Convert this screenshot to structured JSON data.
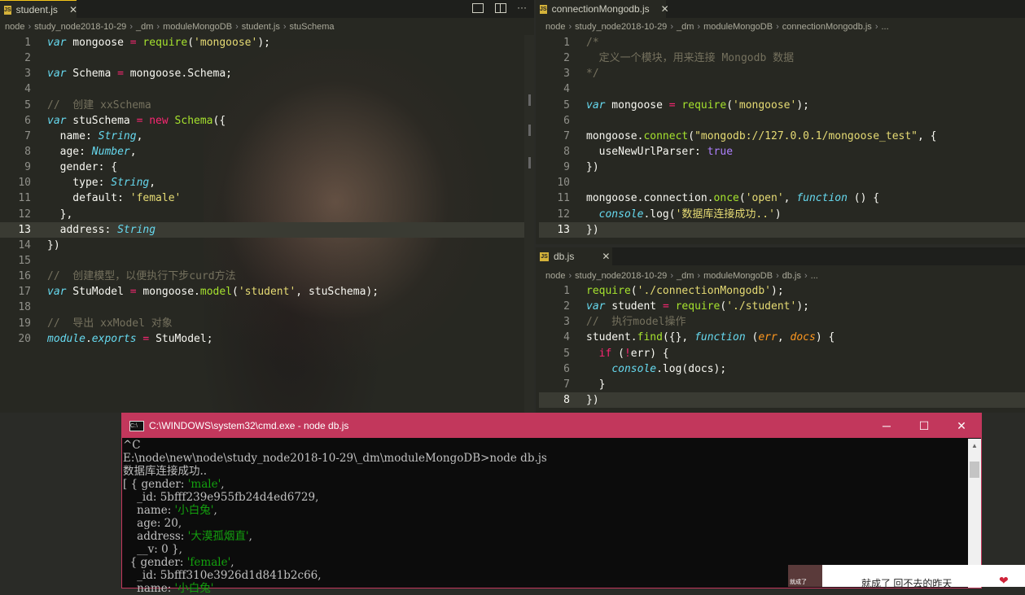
{
  "left_editor": {
    "tab": {
      "label": "student.js",
      "close": "✕"
    },
    "breadcrumb": [
      "node",
      "study_node2018-10-29",
      "_dm",
      "moduleMongoDB",
      "student.js",
      "stuSchema"
    ],
    "lines": [
      [
        [
          "k",
          "var"
        ],
        [
          "t",
          " mongoose "
        ],
        [
          "kw",
          "="
        ],
        [
          "t",
          " "
        ],
        [
          "f",
          "require"
        ],
        [
          "t",
          "("
        ],
        [
          "s",
          "'mongoose'"
        ],
        [
          "t",
          ");"
        ]
      ],
      [],
      [
        [
          "k",
          "var"
        ],
        [
          "t",
          " Schema "
        ],
        [
          "kw",
          "="
        ],
        [
          "t",
          " mongoose.Schema;"
        ]
      ],
      [],
      [
        [
          "cm",
          "//  创建 xxSchema"
        ]
      ],
      [
        [
          "k",
          "var"
        ],
        [
          "t",
          " stuSchema "
        ],
        [
          "kw",
          "="
        ],
        [
          "t",
          " "
        ],
        [
          "kw",
          "new"
        ],
        [
          "t",
          " "
        ],
        [
          "f",
          "Schema"
        ],
        [
          "t",
          "({"
        ]
      ],
      [
        [
          "t",
          "  name: "
        ],
        [
          "ty",
          "String"
        ],
        [
          "t",
          ","
        ]
      ],
      [
        [
          "t",
          "  age: "
        ],
        [
          "ty",
          "Number"
        ],
        [
          "t",
          ","
        ]
      ],
      [
        [
          "t",
          "  gender: {"
        ]
      ],
      [
        [
          "t",
          "    type: "
        ],
        [
          "ty",
          "String"
        ],
        [
          "t",
          ","
        ]
      ],
      [
        [
          "t",
          "    default: "
        ],
        [
          "s",
          "'female'"
        ]
      ],
      [
        [
          "t",
          "  },"
        ]
      ],
      [
        [
          "t",
          "  address: "
        ],
        [
          "ty",
          "String"
        ]
      ],
      [
        [
          "t",
          "})"
        ]
      ],
      [],
      [
        [
          "cm",
          "//  创建模型，以便执行下步curd方法"
        ]
      ],
      [
        [
          "k",
          "var"
        ],
        [
          "t",
          " StuModel "
        ],
        [
          "kw",
          "="
        ],
        [
          "t",
          " mongoose."
        ],
        [
          "f",
          "model"
        ],
        [
          "t",
          "("
        ],
        [
          "s",
          "'student'"
        ],
        [
          "t",
          ", stuSchema);"
        ]
      ],
      [],
      [
        [
          "cm",
          "//  导出 xxModel 对象"
        ]
      ],
      [
        [
          "k",
          "module"
        ],
        [
          "t",
          "."
        ],
        [
          "k",
          "exports"
        ],
        [
          "t",
          " "
        ],
        [
          "kw",
          "="
        ],
        [
          "t",
          " StuModel;"
        ]
      ]
    ]
  },
  "right_top_editor": {
    "tab": {
      "label": "connectionMongodb.js",
      "close": "✕"
    },
    "breadcrumb": [
      "node",
      "study_node2018-10-29",
      "_dm",
      "moduleMongoDB",
      "connectionMongodb.js",
      "..."
    ],
    "lines": [
      [
        [
          "cm",
          "/*"
        ]
      ],
      [
        [
          "cm",
          "  定义一个模块，用来连接 Mongodb 数据"
        ]
      ],
      [
        [
          "cm",
          "*/"
        ]
      ],
      [],
      [
        [
          "k",
          "var"
        ],
        [
          "t",
          " mongoose "
        ],
        [
          "kw",
          "="
        ],
        [
          "t",
          " "
        ],
        [
          "f",
          "require"
        ],
        [
          "t",
          "("
        ],
        [
          "s",
          "'mongoose'"
        ],
        [
          "t",
          ");"
        ]
      ],
      [],
      [
        [
          "t",
          "mongoose."
        ],
        [
          "f",
          "connect"
        ],
        [
          "t",
          "("
        ],
        [
          "s",
          "\"mongodb://127.0.0.1/mongoose_test\""
        ],
        [
          "t",
          ", {"
        ]
      ],
      [
        [
          "t",
          "  useNewUrlParser: "
        ],
        [
          "bool",
          "true"
        ]
      ],
      [
        [
          "t",
          "})"
        ]
      ],
      [],
      [
        [
          "t",
          "mongoose.connection."
        ],
        [
          "f",
          "once"
        ],
        [
          "t",
          "("
        ],
        [
          "s",
          "'open'"
        ],
        [
          "t",
          ", "
        ],
        [
          "k",
          "function"
        ],
        [
          "t",
          " () {"
        ]
      ],
      [
        [
          "t",
          "  "
        ],
        [
          "k",
          "console"
        ],
        [
          "t",
          ".log("
        ],
        [
          "s",
          "'数据库连接成功..'"
        ],
        [
          "t",
          ")"
        ]
      ],
      [
        [
          "t",
          "})"
        ]
      ]
    ]
  },
  "right_bottom_editor": {
    "tab": {
      "label": "db.js",
      "close": "✕"
    },
    "breadcrumb": [
      "node",
      "study_node2018-10-29",
      "_dm",
      "moduleMongoDB",
      "db.js",
      "..."
    ],
    "lines": [
      [
        [
          "f",
          "require"
        ],
        [
          "t",
          "("
        ],
        [
          "s",
          "'./connectionMongodb'"
        ],
        [
          "t",
          ");"
        ]
      ],
      [
        [
          "k",
          "var"
        ],
        [
          "t",
          " student "
        ],
        [
          "kw",
          "="
        ],
        [
          "t",
          " "
        ],
        [
          "f",
          "require"
        ],
        [
          "t",
          "("
        ],
        [
          "s",
          "'./student'"
        ],
        [
          "t",
          ");"
        ]
      ],
      [
        [
          "cm",
          "//  执行model操作"
        ]
      ],
      [
        [
          "t",
          "student."
        ],
        [
          "f",
          "find"
        ],
        [
          "t",
          "({}, "
        ],
        [
          "k",
          "function"
        ],
        [
          "t",
          " ("
        ],
        [
          "par",
          "err"
        ],
        [
          "t",
          ", "
        ],
        [
          "par",
          "docs"
        ],
        [
          "t",
          ") {"
        ]
      ],
      [
        [
          "t",
          "  "
        ],
        [
          "kw",
          "if"
        ],
        [
          "t",
          " ("
        ],
        [
          "kw",
          "!"
        ],
        [
          "t",
          "err) {"
        ]
      ],
      [
        [
          "t",
          "    "
        ],
        [
          "k",
          "console"
        ],
        [
          "t",
          ".log(docs);"
        ]
      ],
      [
        [
          "t",
          "  }"
        ]
      ],
      [
        [
          "t",
          "})"
        ]
      ]
    ]
  },
  "cmd_window": {
    "title": "C:\\WINDOWS\\system32\\cmd.exe - node  db.js",
    "minimize": "─",
    "maximize": "☐",
    "close": "✕",
    "lines": [
      [
        [
          "t",
          "^C"
        ]
      ],
      [
        [
          "t",
          "E:\\node\\new\\node\\study_node2018-10-29\\_dm\\moduleMongoDB>node db.js"
        ]
      ],
      [
        [
          "t",
          "数据库连接成功.."
        ]
      ],
      [
        [
          "t",
          "[ { gender: "
        ],
        [
          "s",
          "'male'"
        ],
        [
          "t",
          ","
        ]
      ],
      [
        [
          "t",
          "    _id: 5bfff239e955fb24d4ed6729,"
        ]
      ],
      [
        [
          "t",
          "    name: "
        ],
        [
          "s",
          "'小白兔'"
        ],
        [
          "t",
          ","
        ]
      ],
      [
        [
          "t",
          "    age: 20,"
        ]
      ],
      [
        [
          "t",
          "    address: "
        ],
        [
          "s",
          "'大漠孤烟直'"
        ],
        [
          "t",
          ","
        ]
      ],
      [
        [
          "t",
          "    __v: 0 },"
        ]
      ],
      [
        [
          "t",
          "  { gender: "
        ],
        [
          "s",
          "'female'"
        ],
        [
          "t",
          ","
        ]
      ],
      [
        [
          "t",
          "    _id: 5bfff310e3926d1d841b2c66,"
        ]
      ],
      [
        [
          "t",
          "    name: "
        ],
        [
          "s",
          "'小白兔'"
        ]
      ]
    ]
  },
  "music_widget": {
    "thumb_caption": "就成了",
    "song": "就成了 回不去的昨天"
  },
  "colors": {
    "accent_tab": "#f5c518",
    "cmd_titlebar": "#c2375c",
    "editor_bg": "#272822"
  }
}
